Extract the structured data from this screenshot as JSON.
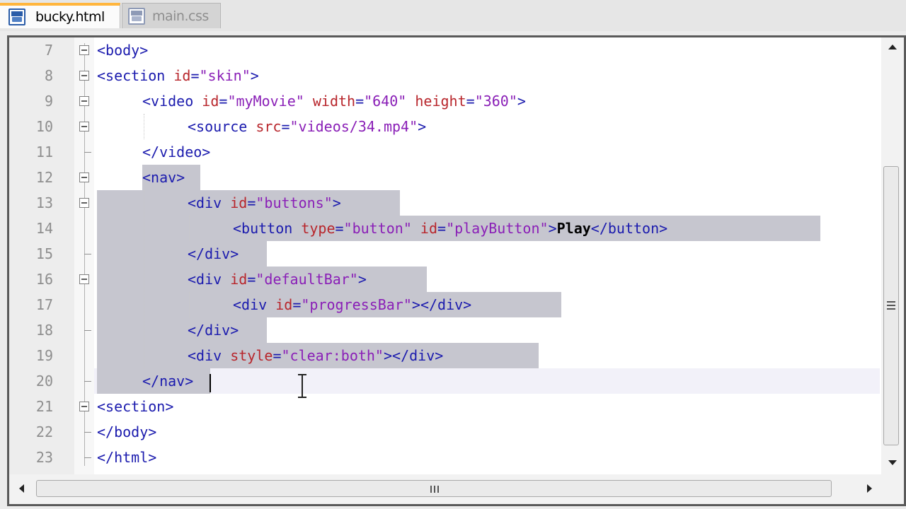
{
  "tabs": [
    {
      "label": "bucky.html",
      "icon": "file-icon",
      "active": true
    },
    {
      "label": "main.css",
      "icon": "file-icon",
      "active": false
    }
  ],
  "colors": {
    "tag": "#1b1bae",
    "attribute": "#b8262c",
    "value": "#8a1fb7",
    "text": "#000000",
    "selection": "#c6c6cf",
    "active_tab_accent": "#ffb53d"
  },
  "editor": {
    "lines": [
      {
        "num": "7",
        "tokens": [
          {
            "c": "t",
            "s": "<body>"
          }
        ]
      },
      {
        "num": "8",
        "tokens": [
          {
            "c": "t",
            "s": "<section "
          },
          {
            "c": "a",
            "s": "id"
          },
          {
            "c": "t",
            "s": "="
          },
          {
            "c": "v",
            "s": "\"skin\""
          },
          {
            "c": "t",
            "s": ">"
          }
        ]
      },
      {
        "num": "9",
        "tokens": [
          {
            "c": "t",
            "s": "<video "
          },
          {
            "c": "a",
            "s": "id"
          },
          {
            "c": "t",
            "s": "="
          },
          {
            "c": "v",
            "s": "\"myMovie\""
          },
          {
            "c": "t",
            "s": " "
          },
          {
            "c": "a",
            "s": "width"
          },
          {
            "c": "t",
            "s": "="
          },
          {
            "c": "v",
            "s": "\"640\""
          },
          {
            "c": "t",
            "s": " "
          },
          {
            "c": "a",
            "s": "height"
          },
          {
            "c": "t",
            "s": "="
          },
          {
            "c": "v",
            "s": "\"360\""
          },
          {
            "c": "t",
            "s": ">"
          }
        ]
      },
      {
        "num": "10",
        "tokens": [
          {
            "c": "t",
            "s": "<source "
          },
          {
            "c": "a",
            "s": "src"
          },
          {
            "c": "t",
            "s": "="
          },
          {
            "c": "v",
            "s": "\"videos/34.mp4\""
          },
          {
            "c": "t",
            "s": ">"
          }
        ]
      },
      {
        "num": "11",
        "tokens": [
          {
            "c": "t",
            "s": "</video>"
          }
        ]
      },
      {
        "num": "12",
        "tokens": [
          {
            "c": "t",
            "s": "<nav>"
          }
        ]
      },
      {
        "num": "13",
        "tokens": [
          {
            "c": "t",
            "s": "<div "
          },
          {
            "c": "a",
            "s": "id"
          },
          {
            "c": "t",
            "s": "="
          },
          {
            "c": "v",
            "s": "\"buttons\""
          },
          {
            "c": "t",
            "s": ">"
          }
        ]
      },
      {
        "num": "14",
        "tokens": [
          {
            "c": "t",
            "s": "<button "
          },
          {
            "c": "a",
            "s": "type"
          },
          {
            "c": "t",
            "s": "="
          },
          {
            "c": "v",
            "s": "\"button\""
          },
          {
            "c": "t",
            "s": " "
          },
          {
            "c": "a",
            "s": "id"
          },
          {
            "c": "t",
            "s": "="
          },
          {
            "c": "v",
            "s": "\"playButton\""
          },
          {
            "c": "t",
            "s": ">"
          },
          {
            "c": "x",
            "s": "Play"
          },
          {
            "c": "t",
            "s": "</button>"
          }
        ]
      },
      {
        "num": "15",
        "tokens": [
          {
            "c": "t",
            "s": "</div>"
          }
        ]
      },
      {
        "num": "16",
        "tokens": [
          {
            "c": "t",
            "s": "<div "
          },
          {
            "c": "a",
            "s": "id"
          },
          {
            "c": "t",
            "s": "="
          },
          {
            "c": "v",
            "s": "\"defaultBar\""
          },
          {
            "c": "t",
            "s": ">"
          }
        ]
      },
      {
        "num": "17",
        "tokens": [
          {
            "c": "t",
            "s": "<div "
          },
          {
            "c": "a",
            "s": "id"
          },
          {
            "c": "t",
            "s": "="
          },
          {
            "c": "v",
            "s": "\"progressBar\""
          },
          {
            "c": "t",
            "s": "></div>"
          }
        ]
      },
      {
        "num": "18",
        "tokens": [
          {
            "c": "t",
            "s": "</div>"
          }
        ]
      },
      {
        "num": "19",
        "tokens": [
          {
            "c": "t",
            "s": "<div "
          },
          {
            "c": "a",
            "s": "style"
          },
          {
            "c": "t",
            "s": "="
          },
          {
            "c": "v",
            "s": "\"clear:both\""
          },
          {
            "c": "t",
            "s": "></div>"
          }
        ]
      },
      {
        "num": "20",
        "tokens": [
          {
            "c": "t",
            "s": "</nav>"
          }
        ]
      },
      {
        "num": "21",
        "tokens": [
          {
            "c": "t",
            "s": "<section>"
          }
        ]
      },
      {
        "num": "22",
        "tokens": [
          {
            "c": "t",
            "s": "</body>"
          }
        ]
      },
      {
        "num": "23",
        "tokens": [
          {
            "c": "t",
            "s": "</html>"
          }
        ]
      }
    ]
  }
}
